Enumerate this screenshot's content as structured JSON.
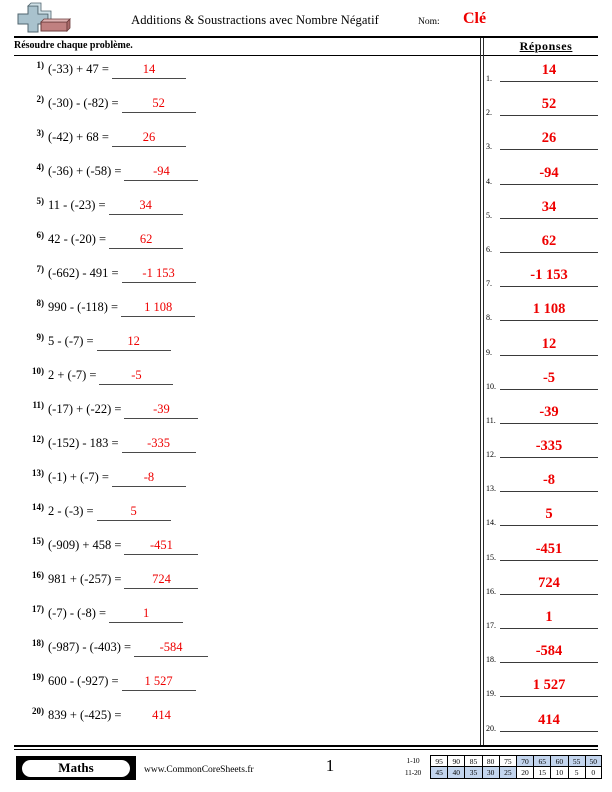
{
  "header": {
    "logo_name": "plus-minus-logo",
    "title": "Additions & Soustractions avec Nombre Négatif",
    "name_label": "Nom:",
    "name_value": "Clé"
  },
  "instruction": {
    "text": "Résoudre chaque problème.",
    "answers_heading": "Réponses"
  },
  "problems": [
    {
      "num": "1)",
      "expr": "(-33) + 47 =",
      "answer": "14"
    },
    {
      "num": "2)",
      "expr": "(-30) - (-82) =",
      "answer": "52"
    },
    {
      "num": "3)",
      "expr": "(-42) + 68 =",
      "answer": "26"
    },
    {
      "num": "4)",
      "expr": "(-36) + (-58) =",
      "answer": "-94"
    },
    {
      "num": "5)",
      "expr": "11 - (-23) =",
      "answer": "34"
    },
    {
      "num": "6)",
      "expr": "42 - (-20) =",
      "answer": "62"
    },
    {
      "num": "7)",
      "expr": "(-662) - 491 =",
      "answer": "-1 153"
    },
    {
      "num": "8)",
      "expr": "990 - (-118) =",
      "answer": "1 108"
    },
    {
      "num": "9)",
      "expr": "5 - (-7) =",
      "answer": "12"
    },
    {
      "num": "10)",
      "expr": "2 + (-7) =",
      "answer": "-5"
    },
    {
      "num": "11)",
      "expr": "(-17) + (-22) =",
      "answer": "-39"
    },
    {
      "num": "12)",
      "expr": "(-152) - 183 =",
      "answer": "-335"
    },
    {
      "num": "13)",
      "expr": "(-1) + (-7) =",
      "answer": "-8"
    },
    {
      "num": "14)",
      "expr": "2 - (-3) =",
      "answer": "5"
    },
    {
      "num": "15)",
      "expr": "(-909) + 458 =",
      "answer": "-451"
    },
    {
      "num": "16)",
      "expr": "981 + (-257) =",
      "answer": "724"
    },
    {
      "num": "17)",
      "expr": "(-7) - (-8) =",
      "answer": "1"
    },
    {
      "num": "18)",
      "expr": "(-987) - (-403) =",
      "answer": "-584"
    },
    {
      "num": "19)",
      "expr": "600 - (-927) =",
      "answer": "1 527"
    },
    {
      "num": "20)",
      "expr": "839 + (-425) =",
      "answer": "414"
    }
  ],
  "answer_key": [
    {
      "num": "1.",
      "value": "14"
    },
    {
      "num": "2.",
      "value": "52"
    },
    {
      "num": "3.",
      "value": "26"
    },
    {
      "num": "4.",
      "value": "-94"
    },
    {
      "num": "5.",
      "value": "34"
    },
    {
      "num": "6.",
      "value": "62"
    },
    {
      "num": "7.",
      "value": "-1 153"
    },
    {
      "num": "8.",
      "value": "1 108"
    },
    {
      "num": "9.",
      "value": "12"
    },
    {
      "num": "10.",
      "value": "-5"
    },
    {
      "num": "11.",
      "value": "-39"
    },
    {
      "num": "12.",
      "value": "-335"
    },
    {
      "num": "13.",
      "value": "-8"
    },
    {
      "num": "14.",
      "value": "5"
    },
    {
      "num": "15.",
      "value": "-451"
    },
    {
      "num": "16.",
      "value": "724"
    },
    {
      "num": "17.",
      "value": "1"
    },
    {
      "num": "18.",
      "value": "-584"
    },
    {
      "num": "19.",
      "value": "1 527"
    },
    {
      "num": "20.",
      "value": "414"
    }
  ],
  "footer": {
    "brand": "Maths",
    "site_url": "www.CommonCoreSheets.fr",
    "page_number": "1"
  },
  "grade_scale": {
    "rows": [
      {
        "label": "1-10",
        "cells": [
          {
            "value": "95",
            "highlight": false
          },
          {
            "value": "90",
            "highlight": false
          },
          {
            "value": "85",
            "highlight": false
          },
          {
            "value": "80",
            "highlight": false
          },
          {
            "value": "75",
            "highlight": false
          },
          {
            "value": "70",
            "highlight": true
          },
          {
            "value": "65",
            "highlight": true
          },
          {
            "value": "60",
            "highlight": true
          },
          {
            "value": "55",
            "highlight": true
          },
          {
            "value": "50",
            "highlight": true
          }
        ]
      },
      {
        "label": "11-20",
        "cells": [
          {
            "value": "45",
            "highlight": true
          },
          {
            "value": "40",
            "highlight": true
          },
          {
            "value": "35",
            "highlight": true
          },
          {
            "value": "30",
            "highlight": true
          },
          {
            "value": "25",
            "highlight": true
          },
          {
            "value": "20",
            "highlight": false
          },
          {
            "value": "15",
            "highlight": false
          },
          {
            "value": "10",
            "highlight": false
          },
          {
            "value": "5",
            "highlight": false
          },
          {
            "value": "0",
            "highlight": false
          }
        ]
      }
    ]
  },
  "colors": {
    "answer_red": "#ee0000",
    "highlight_blue": "#c3d5ee",
    "logo_plus": "#9fb8c4",
    "logo_minus": "#c08080"
  }
}
